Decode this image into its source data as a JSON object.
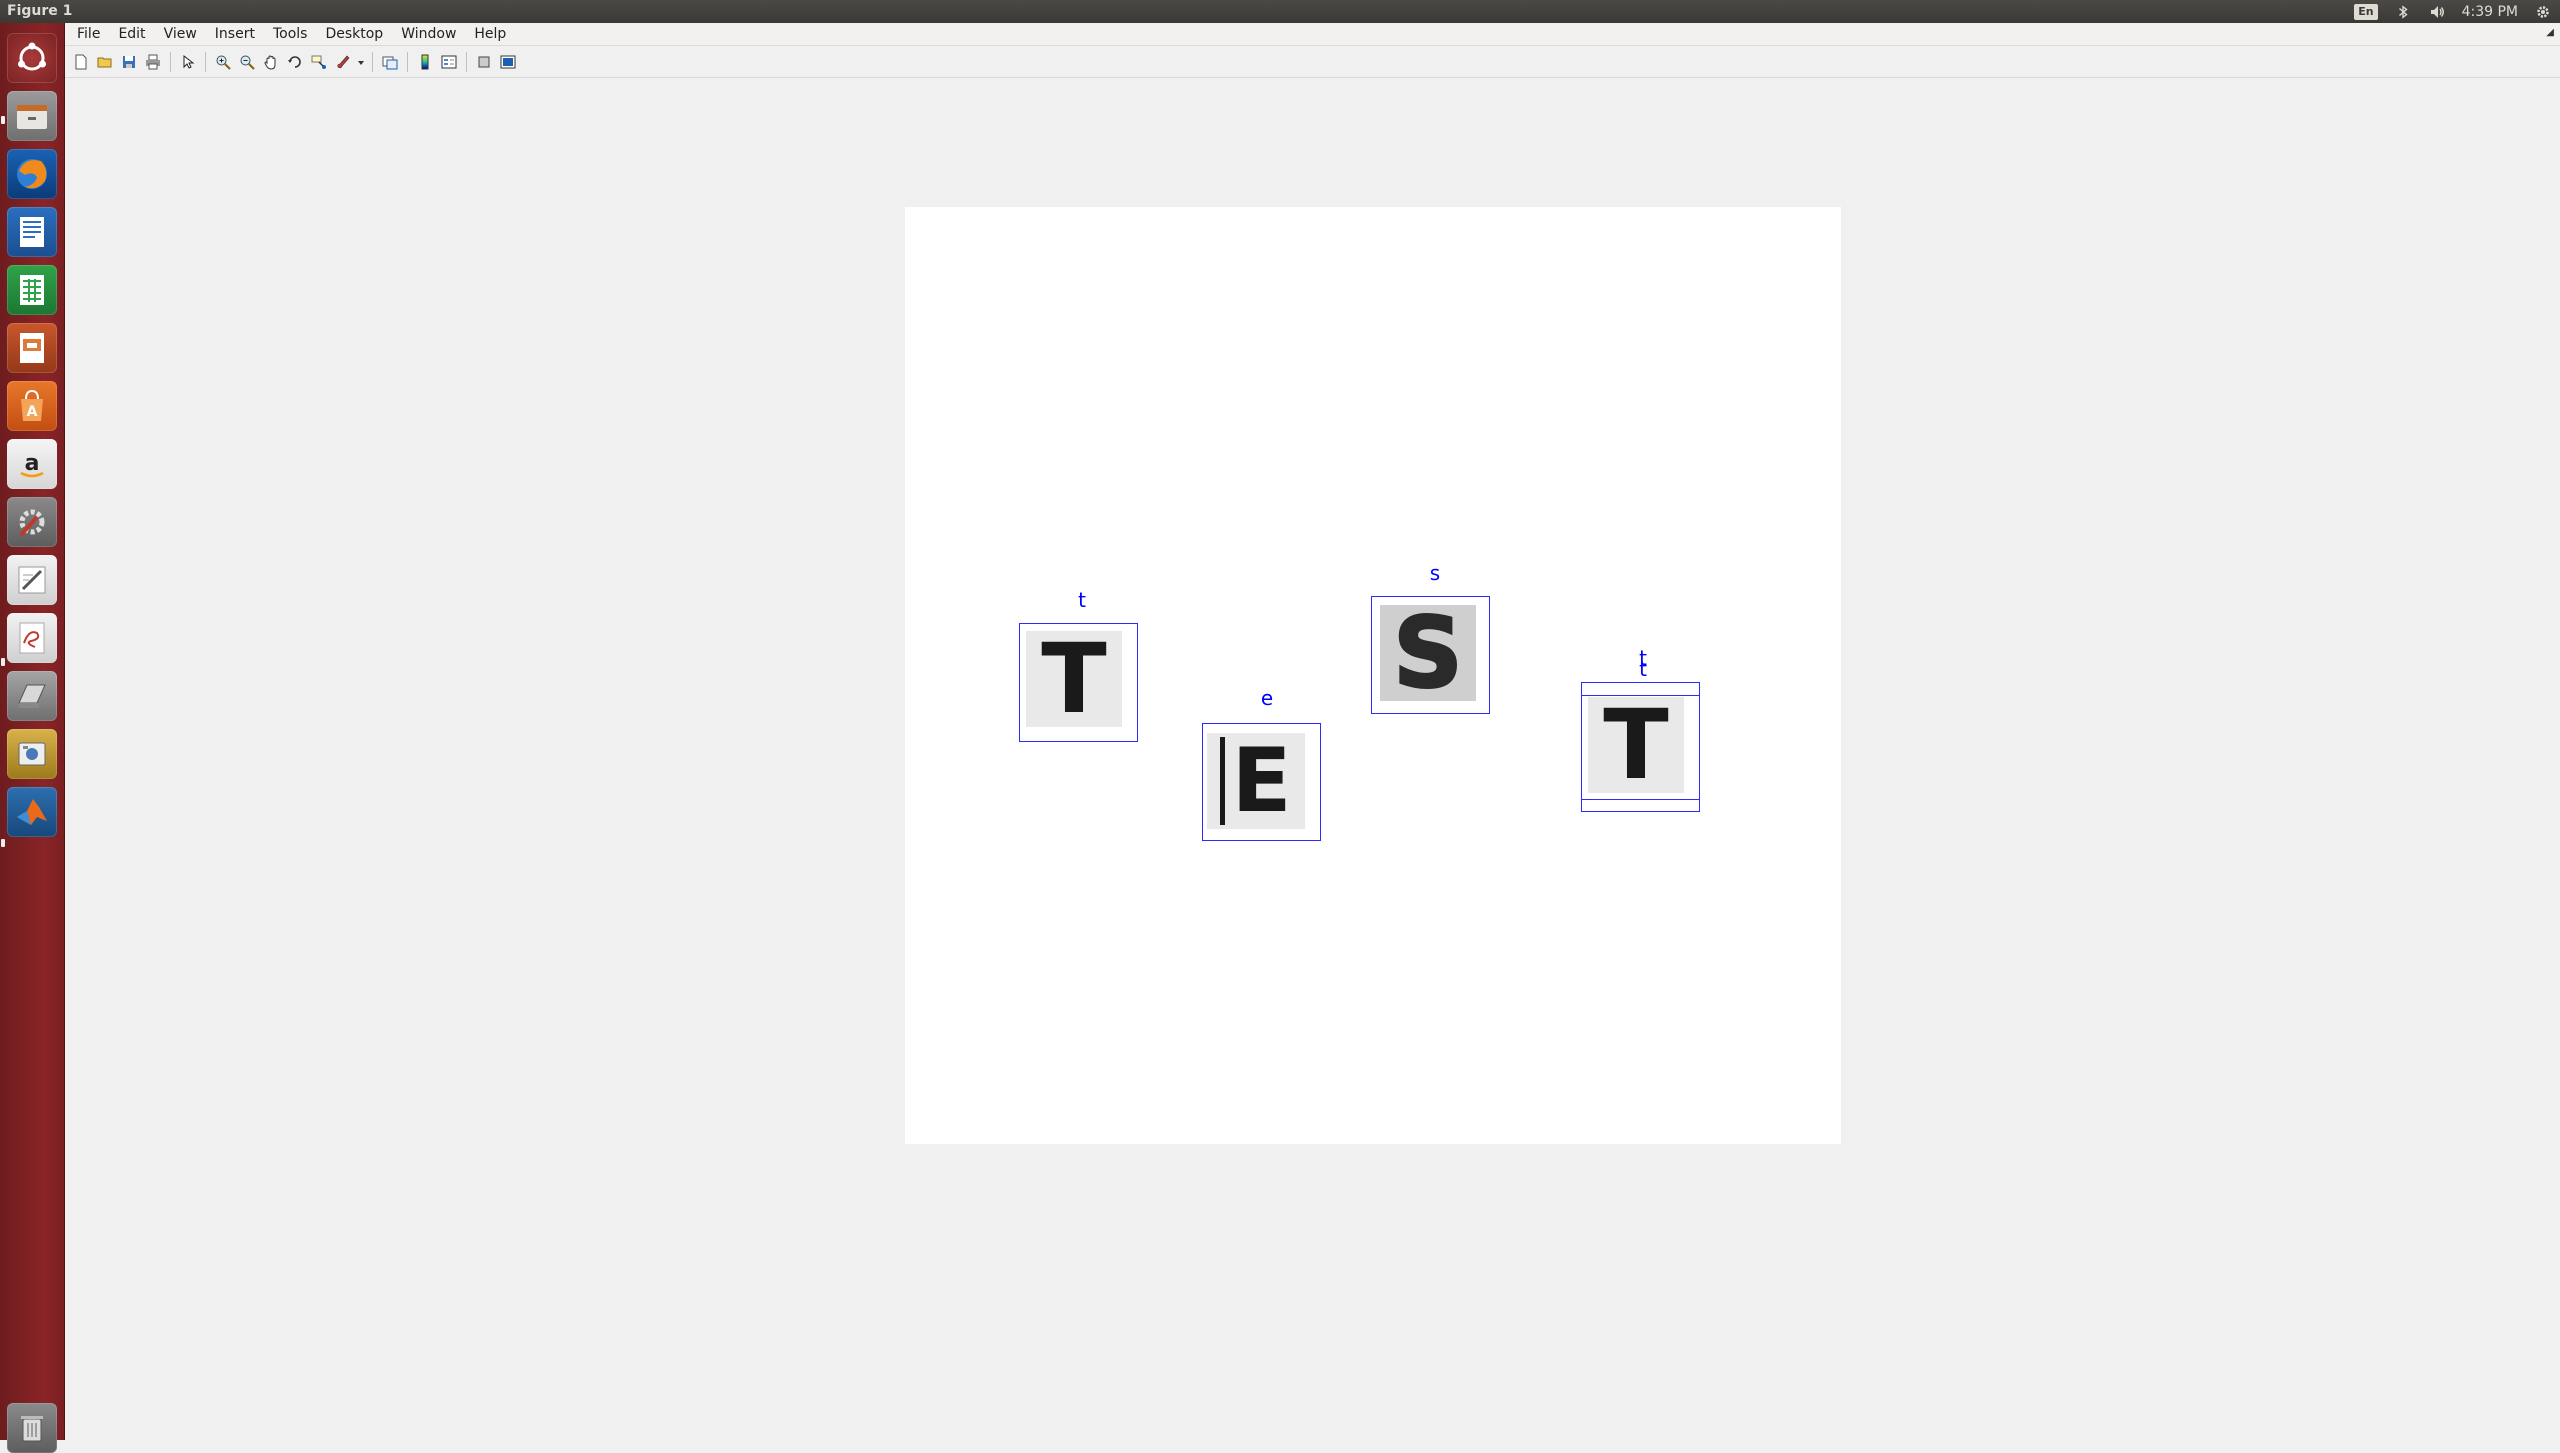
{
  "window": {
    "title": "Figure 1"
  },
  "tray": {
    "keyboard": "En",
    "time": "4:39 PM"
  },
  "menubar": {
    "items": [
      "File",
      "Edit",
      "View",
      "Insert",
      "Tools",
      "Desktop",
      "Window",
      "Help"
    ]
  },
  "launcher": {
    "items": [
      "dash-home",
      "files",
      "firefox",
      "libreoffice-writer",
      "libreoffice-calc",
      "libreoffice-impress",
      "ubuntu-software-center",
      "amazon",
      "system-settings",
      "text-editor",
      "document-viewer",
      "scanner",
      "screenshot",
      "matlab",
      "trash"
    ]
  },
  "toolbar": {
    "buttons": [
      "new-figure",
      "open-file",
      "save-figure",
      "print-figure",
      "edit-plot",
      "zoom-in",
      "zoom-out",
      "pan",
      "rotate-3d",
      "data-cursor",
      "brush",
      "link-plot",
      "insert-colorbar",
      "insert-legend",
      "hide-plot-tools",
      "show-plot-tools"
    ]
  },
  "detections": [
    {
      "id": "d1",
      "label": "t",
      "glyph": "T"
    },
    {
      "id": "d2",
      "label": "e",
      "glyph": "E"
    },
    {
      "id": "d3",
      "label": "s",
      "glyph": "S"
    },
    {
      "id": "d4",
      "label": "t",
      "label2": "t",
      "glyph": "T"
    }
  ],
  "colors": {
    "box": "#0000ff",
    "launcher": "#8a2427",
    "panel": "#3c3b37"
  }
}
